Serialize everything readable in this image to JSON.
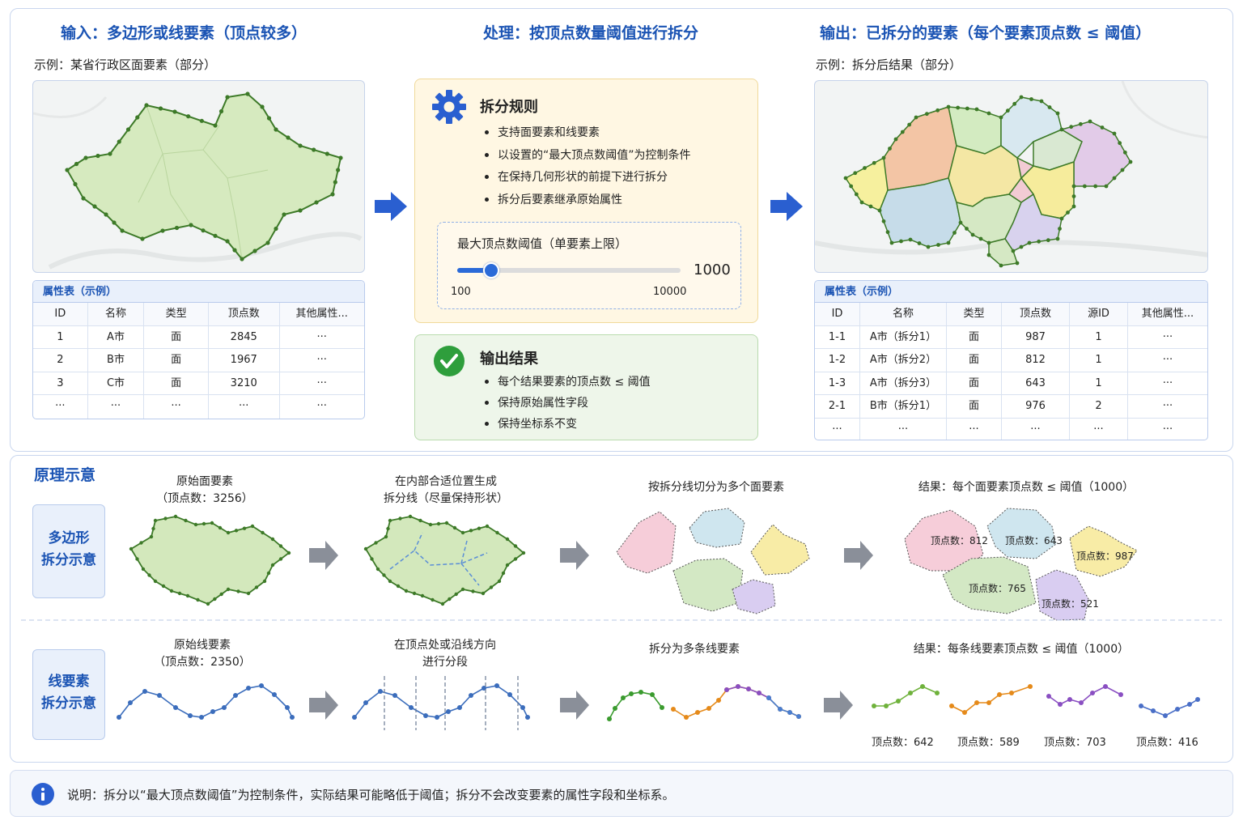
{
  "input": {
    "heading": "输入：多边形或线要素（顶点较多）",
    "caption": "示例：某省行政区面要素（部分）",
    "table_title": "属性表（示例）",
    "columns": [
      "ID",
      "名称",
      "类型",
      "顶点数",
      "其他属性..."
    ],
    "rows": [
      [
        "1",
        "A市",
        "面",
        "2845",
        "···"
      ],
      [
        "2",
        "B市",
        "面",
        "1967",
        "···"
      ],
      [
        "3",
        "C市",
        "面",
        "3210",
        "···"
      ],
      [
        "···",
        "···",
        "···",
        "···",
        "···"
      ]
    ]
  },
  "process": {
    "heading": "处理：按顶点数量阈值进行拆分",
    "rules_title": "拆分规则",
    "rules": [
      "支持面要素和线要素",
      "以设置的“最大顶点数阈值”为控制条件",
      "在保持几何形状的前提下进行拆分",
      "拆分后要素继承原始属性"
    ],
    "threshold_label": "最大顶点数阈值（单要素上限）",
    "slider_value": "1000",
    "slider_min": "100",
    "slider_max": "10000",
    "slider_fraction": 0.1,
    "result_title": "输出结果",
    "results": [
      "每个结果要素的顶点数 ≤ 阈值",
      "保持原始属性字段",
      "保持坐标系不变"
    ]
  },
  "output": {
    "heading": "输出：已拆分的要素（每个要素顶点数 ≤ 阈值）",
    "caption": "示例：拆分后结果（部分）",
    "table_title": "属性表（示例）",
    "columns": [
      "ID",
      "名称",
      "类型",
      "顶点数",
      "源ID",
      "其他属性..."
    ],
    "rows": [
      [
        "1-1",
        "A市（拆分1）",
        "面",
        "987",
        "1",
        "···"
      ],
      [
        "1-2",
        "A市（拆分2）",
        "面",
        "812",
        "1",
        "···"
      ],
      [
        "1-3",
        "A市（拆分3）",
        "面",
        "643",
        "1",
        "···"
      ],
      [
        "2-1",
        "B市（拆分1）",
        "面",
        "976",
        "2",
        "···"
      ],
      [
        "···",
        "···",
        "···",
        "···",
        "···",
        "···"
      ]
    ]
  },
  "principle": {
    "title": "原理示意",
    "polygon_tag": [
      "多边形",
      "拆分示意"
    ],
    "polygon_steps": [
      [
        "原始面要素",
        "（顶点数：3256）"
      ],
      [
        "在内部合适位置生成",
        "拆分线（尽量保持形状）"
      ],
      [
        "按拆分线切分为多个面要素"
      ],
      [
        "结果：每个面要素顶点数 ≤ 阈值（1000）"
      ]
    ],
    "polygon_labels": [
      "顶点数：812",
      "顶点数：643",
      "顶点数：987",
      "顶点数：765",
      "顶点数：521"
    ],
    "line_tag": [
      "线要素",
      "拆分示意"
    ],
    "line_steps": [
      [
        "原始线要素",
        "（顶点数：2350）"
      ],
      [
        "在顶点处或沿线方向",
        "进行分段"
      ],
      [
        "拆分为多条线要素"
      ],
      [
        "结果：每条线要素顶点数 ≤ 阈值（1000）"
      ]
    ],
    "line_labels": [
      "顶点数：642",
      "顶点数：589",
      "顶点数：703",
      "顶点数：416"
    ]
  },
  "note": "说明：拆分以“最大顶点数阈值”为控制条件，实际结果可能略低于阈值；拆分不会改变要素的属性字段和坐标系。",
  "colors": {
    "accent": "#1b54b4",
    "arrow": "#2a5fd0",
    "polygon_fill": "#d3e8bc",
    "polygon_stroke": "#3d7a28",
    "rules_bg": "#fff7e3",
    "result_bg": "#eef6ea",
    "check": "#2e9e3c"
  }
}
